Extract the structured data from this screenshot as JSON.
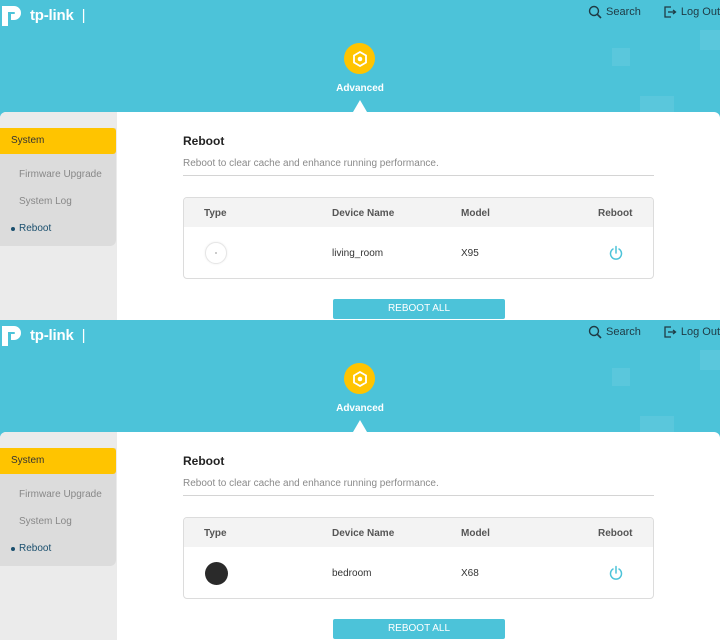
{
  "brand": {
    "name": "tp-link",
    "separator": "|"
  },
  "header": {
    "search_label": "Search",
    "logout_label": "Log Out"
  },
  "nav": {
    "active_section": "Advanced"
  },
  "sidebar": {
    "section": "System",
    "items": [
      {
        "label": "Firmware Upgrade"
      },
      {
        "label": "System Log"
      },
      {
        "label": "Reboot",
        "active": true
      }
    ]
  },
  "page": {
    "title": "Reboot",
    "description": "Reboot to clear cache and enhance running performance.",
    "table_headers": {
      "type": "Type",
      "device_name": "Device Name",
      "model": "Model",
      "reboot": "Reboot"
    },
    "reboot_all_label": "REBOOT ALL"
  },
  "screens": [
    {
      "device": {
        "name": "living_room",
        "model": "X95",
        "type_icon": "device-placeholder-icon"
      }
    },
    {
      "device": {
        "name": "bedroom",
        "model": "X68",
        "type_icon": "device-dark-circle-icon"
      }
    }
  ],
  "colors": {
    "header_bg": "#4cc3d9",
    "accent": "#ffc400",
    "primary_button": "#4cc3d9",
    "power_icon": "#4cc3d9"
  }
}
